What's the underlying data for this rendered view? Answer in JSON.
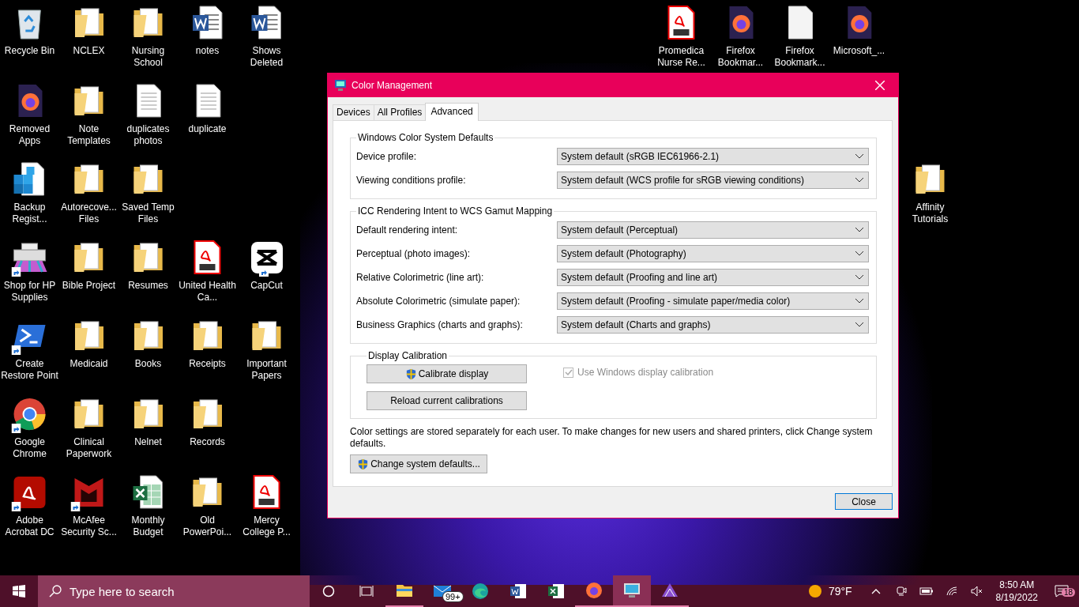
{
  "desktop_icons": [
    {
      "label": "Recycle Bin",
      "kind": "recycle",
      "shortcut": false
    },
    {
      "label": "NCLEX",
      "kind": "folder",
      "shortcut": false
    },
    {
      "label": "Nursing School",
      "kind": "folder",
      "shortcut": false
    },
    {
      "label": "notes",
      "kind": "word",
      "shortcut": false
    },
    {
      "label": "Shows Deleted",
      "kind": "word",
      "shortcut": false
    },
    {
      "label": "Promedica Nurse Re...",
      "kind": "pdf",
      "shortcut": false
    },
    {
      "label": "Firefox Bookmar...",
      "kind": "firefox",
      "shortcut": false
    },
    {
      "label": "Firefox Bookmark...",
      "kind": "blank",
      "shortcut": false
    },
    {
      "label": "Microsoft_...",
      "kind": "firefox",
      "shortcut": false
    },
    {
      "label": "Removed Apps",
      "kind": "firefox",
      "shortcut": false
    },
    {
      "label": "Note Templates",
      "kind": "folder",
      "shortcut": false
    },
    {
      "label": "duplicates photos",
      "kind": "text",
      "shortcut": false
    },
    {
      "label": "duplicate",
      "kind": "text",
      "shortcut": false
    },
    {
      "label": "Backup Regist...",
      "kind": "registry",
      "shortcut": false
    },
    {
      "label": "Autorecove... Files",
      "kind": "folder",
      "shortcut": false
    },
    {
      "label": "Saved Temp Files",
      "kind": "folder",
      "shortcut": false
    },
    {
      "label": "Affinity Tutorials",
      "kind": "folder",
      "shortcut": false
    },
    {
      "label": "Shop for HP Supplies",
      "kind": "printer",
      "shortcut": true
    },
    {
      "label": "Bible Project",
      "kind": "folder",
      "shortcut": false
    },
    {
      "label": "Resumes",
      "kind": "folder",
      "shortcut": false
    },
    {
      "label": "United Health Ca...",
      "kind": "pdf",
      "shortcut": false
    },
    {
      "label": "CapCut",
      "kind": "capcut",
      "shortcut": true
    },
    {
      "label": "Create Restore Point",
      "kind": "powershell",
      "shortcut": true
    },
    {
      "label": "Medicaid",
      "kind": "folder",
      "shortcut": false
    },
    {
      "label": "Books",
      "kind": "folder",
      "shortcut": false
    },
    {
      "label": "Receipts",
      "kind": "folder",
      "shortcut": false
    },
    {
      "label": "Important Papers",
      "kind": "folder",
      "shortcut": false
    },
    {
      "label": "Google Chrome",
      "kind": "chrome",
      "shortcut": true
    },
    {
      "label": "Clinical Paperwork",
      "kind": "folder",
      "shortcut": false
    },
    {
      "label": "Nelnet",
      "kind": "folder",
      "shortcut": false
    },
    {
      "label": "Records",
      "kind": "folder",
      "shortcut": false
    },
    {
      "label": "Adobe Acrobat DC",
      "kind": "acrobat",
      "shortcut": true
    },
    {
      "label": "McAfee Security Sc...",
      "kind": "mcafee",
      "shortcut": true
    },
    {
      "label": "Monthly Budget",
      "kind": "excel",
      "shortcut": false
    },
    {
      "label": "Old PowerPoi...",
      "kind": "folder",
      "shortcut": false
    },
    {
      "label": "Mercy College P...",
      "kind": "pdf",
      "shortcut": false
    }
  ],
  "window": {
    "title": "Color Management",
    "tabs": [
      {
        "label": "Devices",
        "selected": false
      },
      {
        "label": "All Profiles",
        "selected": false
      },
      {
        "label": "Advanced",
        "selected": true
      }
    ],
    "groups": [
      {
        "title": "Windows Color System Defaults",
        "rows": [
          {
            "label": "Device profile:",
            "value": "System default (sRGB IEC61966-2.1)"
          },
          {
            "label": "Viewing conditions profile:",
            "value": "System default (WCS profile for sRGB viewing conditions)"
          }
        ]
      },
      {
        "title": "ICC Rendering Intent to WCS Gamut Mapping",
        "rows": [
          {
            "label": "Default rendering intent:",
            "value": "System default (Perceptual)"
          },
          {
            "label": "Perceptual (photo images):",
            "value": "System default (Photography)"
          },
          {
            "label": "Relative Colorimetric (line art):",
            "value": "System default (Proofing and line art)"
          },
          {
            "label": "Absolute Colorimetric (simulate paper):",
            "value": "System default (Proofing - simulate paper/media color)"
          },
          {
            "label": "Business Graphics (charts and graphs):",
            "value": "System default (Charts and graphs)"
          }
        ]
      }
    ],
    "calibration": {
      "title": "Display Calibration",
      "calibrate_button": "Calibrate display",
      "reload_button": "Reload current calibrations",
      "checkbox": {
        "label": "Use Windows display calibration",
        "checked": true,
        "disabled": true
      }
    },
    "note": "Color settings are stored separately for each user. To make changes for new users and shared printers, click Change system defaults.",
    "system_defaults_button": "Change system defaults...",
    "close_button": "Close"
  },
  "taskbar": {
    "search_placeholder": "Type here to search",
    "apps": [
      {
        "kind": "explorer",
        "running": true,
        "selected": false
      },
      {
        "kind": "mail",
        "running": false,
        "selected": false,
        "badge": "99+"
      },
      {
        "kind": "edge",
        "running": false,
        "selected": false
      },
      {
        "kind": "word",
        "running": false,
        "selected": false
      },
      {
        "kind": "excel",
        "running": false,
        "selected": false
      },
      {
        "kind": "firefox",
        "running": true,
        "selected": false
      },
      {
        "kind": "monitor",
        "running": true,
        "selected": true
      },
      {
        "kind": "affinity",
        "running": true,
        "selected": false
      }
    ],
    "weather": "79°F",
    "time": "8:50 AM",
    "date": "8/19/2022",
    "notifications": "18"
  }
}
